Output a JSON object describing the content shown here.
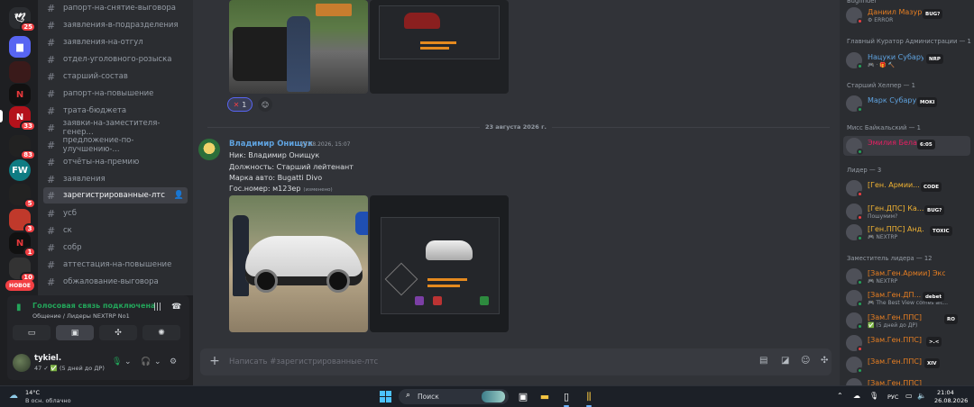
{
  "servers": [
    {
      "label": "",
      "badge": "25"
    },
    {
      "label": "",
      "badge": ""
    },
    {
      "label": "",
      "badge": ""
    },
    {
      "label": "",
      "badge": "1"
    },
    {
      "label": "N",
      "badge": ""
    },
    {
      "label": "N",
      "badge": "33"
    },
    {
      "label": "",
      "badge": "83"
    },
    {
      "label": "FW",
      "badge": ""
    },
    {
      "label": "",
      "badge": "5"
    },
    {
      "label": "",
      "badge": "3"
    },
    {
      "label": "N",
      "badge": "1"
    },
    {
      "label": "",
      "badge": "10"
    }
  ],
  "new_badge": "НОВОЕ",
  "channels": [
    {
      "label": "рапорт-на-снятие-выговора",
      "active": false
    },
    {
      "label": "заявления-в-подразделения",
      "active": false
    },
    {
      "label": "заявления-на-отгул",
      "active": false
    },
    {
      "label": "отдел-уголовного-розыска",
      "active": false
    },
    {
      "label": "старший-состав",
      "active": false
    },
    {
      "label": "рапорт-на-повышение",
      "active": false
    },
    {
      "label": "трата-бюджета",
      "active": false
    },
    {
      "label": "заявки-на-заместителя-генер...",
      "active": false
    },
    {
      "label": "предложение-по-улучшению-...",
      "active": false
    },
    {
      "label": "отчёты-на-премию",
      "active": false
    },
    {
      "label": "заявления",
      "active": false
    },
    {
      "label": "зарегистрированные-лтс",
      "active": true
    },
    {
      "label": "усб",
      "active": false
    },
    {
      "label": "ск",
      "active": false
    },
    {
      "label": "собр",
      "active": false
    },
    {
      "label": "аттестация-на-повышение",
      "active": false
    },
    {
      "label": "обжалование-выговора",
      "active": false
    }
  ],
  "voice": {
    "title": "Голосовая связь подключена",
    "subtitle": "Общение / Лидеры NEXTRP No1"
  },
  "user": {
    "name": "tykiel.",
    "status": "47 ✓ ✅ (5 дней до ДР)"
  },
  "chat": {
    "reaction_count": "1",
    "date_divider": "23 августа 2026 г.",
    "message": {
      "author": "Владимир Онищук",
      "time": "23.08.2026, 15:07",
      "lines": [
        "Ник: Владимир Онищук",
        "Должность: Старший лейтенант",
        "Марка авто:  Bugatti Divo",
        "Гос.номер: м123ер"
      ],
      "edited": "(изменено)"
    },
    "composer_placeholder": "Написать #зарегистрированные-лтс"
  },
  "members": {
    "top_partial": "Bugfinder",
    "sections": [
      {
        "title": "Главный Куратор Администрации — 1"
      },
      {
        "title": "Старший Хелпер — 1"
      },
      {
        "title": "Мисс Байкальский — 1"
      },
      {
        "title": "Лидер — 3"
      },
      {
        "title": "Заместитель лидера — 12"
      }
    ],
    "items": [
      {
        "name": "Даниил Мазур",
        "sub": "⚙ ERROR",
        "tag": "BUG?",
        "color": "#e67e22",
        "dot": "#f23f43"
      },
      {
        "name": "Нацуки Субару",
        "sub": "🎮 · 🎁 🔨",
        "tag": "NRP",
        "color": "#5fa3e0",
        "dot": "#23a55a"
      },
      {
        "name": "Марк Субару",
        "sub": "",
        "tag": "MOKI",
        "color": "#5fa3e0",
        "dot": "#23a55a"
      },
      {
        "name": "Эмилия Бела...",
        "sub": "",
        "tag": "6:05",
        "color": "#e91e63",
        "dot": "#23a55a"
      },
      {
        "name": "[Ген. Армии...",
        "sub": "",
        "tag": "CODE",
        "color": "#f0b232",
        "dot": "#f23f43"
      },
      {
        "name": "[Ген.ДПС] Ка...",
        "sub": "Пошумим?",
        "tag": "BUG?",
        "color": "#f0b232",
        "dot": "#f23f43"
      },
      {
        "name": "[Ген.ППС] Анд...",
        "sub": "🎮 NEXTRP",
        "tag": "TOXIC",
        "color": "#f0b232",
        "dot": "#23a55a"
      },
      {
        "name": "[Зам.Ген.Армии] Экси М...",
        "sub": "🎮 NEXTRP",
        "tag": "",
        "color": "#e67e22",
        "dot": "#23a55a"
      },
      {
        "name": "[Зам.Ген.ДП...",
        "sub": "🎮 The Best View comes aft...",
        "tag": "debet",
        "color": "#e67e22",
        "dot": "#23a55a"
      },
      {
        "name": "[Зам.Ген.ППС] Арт...",
        "sub": "✅ (5 дней до ДР)",
        "tag": "RO",
        "color": "#e67e22",
        "dot": "#23a55a"
      },
      {
        "name": "[Зам.Ген.ППС] ...",
        "sub": "",
        "tag": ">.<",
        "color": "#e67e22",
        "dot": "#f23f43"
      },
      {
        "name": "[Зам.Ген.ППС] ...",
        "sub": "",
        "tag": "XIV",
        "color": "#e67e22",
        "dot": "#23a55a"
      },
      {
        "name": "[Зам.Ген.ППС] ...",
        "sub": "",
        "tag": "",
        "color": "#e67e22",
        "dot": "#23a55a"
      }
    ]
  },
  "taskbar": {
    "temperature": "14°C",
    "weather": "В осн. облачно",
    "search": "Поиск",
    "language": "РУС",
    "time": "21:04",
    "date": "26.08.2026"
  }
}
